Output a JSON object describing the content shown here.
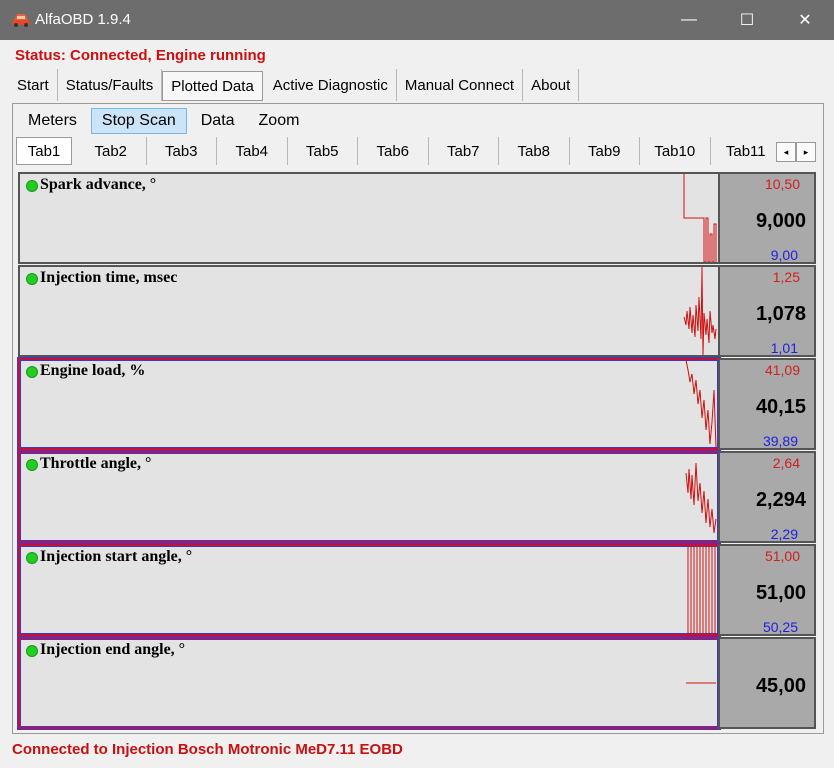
{
  "window": {
    "title": "AlfaOBD 1.9.4",
    "controls": {
      "minimize": "—",
      "maximize": "☐",
      "close": "✕"
    }
  },
  "status_line": "Status: Connected, Engine running",
  "main_tabs": [
    {
      "label": "Start"
    },
    {
      "label": "Status/Faults"
    },
    {
      "label": "Plotted Data",
      "active": true
    },
    {
      "label": "Active Diagnostic"
    },
    {
      "label": "Manual Connect"
    },
    {
      "label": "About"
    }
  ],
  "sub_menu": [
    {
      "label": "Meters"
    },
    {
      "label": "Stop Scan",
      "active": true
    },
    {
      "label": "Data"
    },
    {
      "label": "Zoom"
    }
  ],
  "data_tabs": [
    "Tab1",
    "Tab2",
    "Tab3",
    "Tab4",
    "Tab5",
    "Tab6",
    "Tab7",
    "Tab8",
    "Tab9",
    "Tab10",
    "Tab11"
  ],
  "scroll": {
    "left": "◂",
    "right": "▸"
  },
  "plots": [
    {
      "label": "Spark advance, °",
      "max": "10,50",
      "current": "9,000",
      "min": "9,00",
      "highlighted": false
    },
    {
      "label": "Injection time, msec",
      "max": "1,25",
      "current": "1,078",
      "min": "1,01",
      "highlighted": false
    },
    {
      "label": "Engine load, %",
      "max": "41,09",
      "current": "40,15",
      "min": "39,89",
      "highlighted": true
    },
    {
      "label": "Throttle angle, °",
      "max": "2,64",
      "current": "2,294",
      "min": "2,29",
      "highlighted": true
    },
    {
      "label": "Injection start angle, °",
      "max": "51,00",
      "current": "51,00",
      "min": "50,25",
      "highlighted": true
    },
    {
      "label": "Injection end angle, °",
      "max": "",
      "current": "45,00",
      "min": "",
      "highlighted": true
    }
  ],
  "colors": {
    "trace": "#d01010",
    "max_text": "#d02020",
    "min_text": "#2020e0",
    "status_text": "#cc1010",
    "indicator": "#22cc22"
  },
  "footer_status": "Connected to Injection Bosch Motronic MeD7.11 EOBD"
}
